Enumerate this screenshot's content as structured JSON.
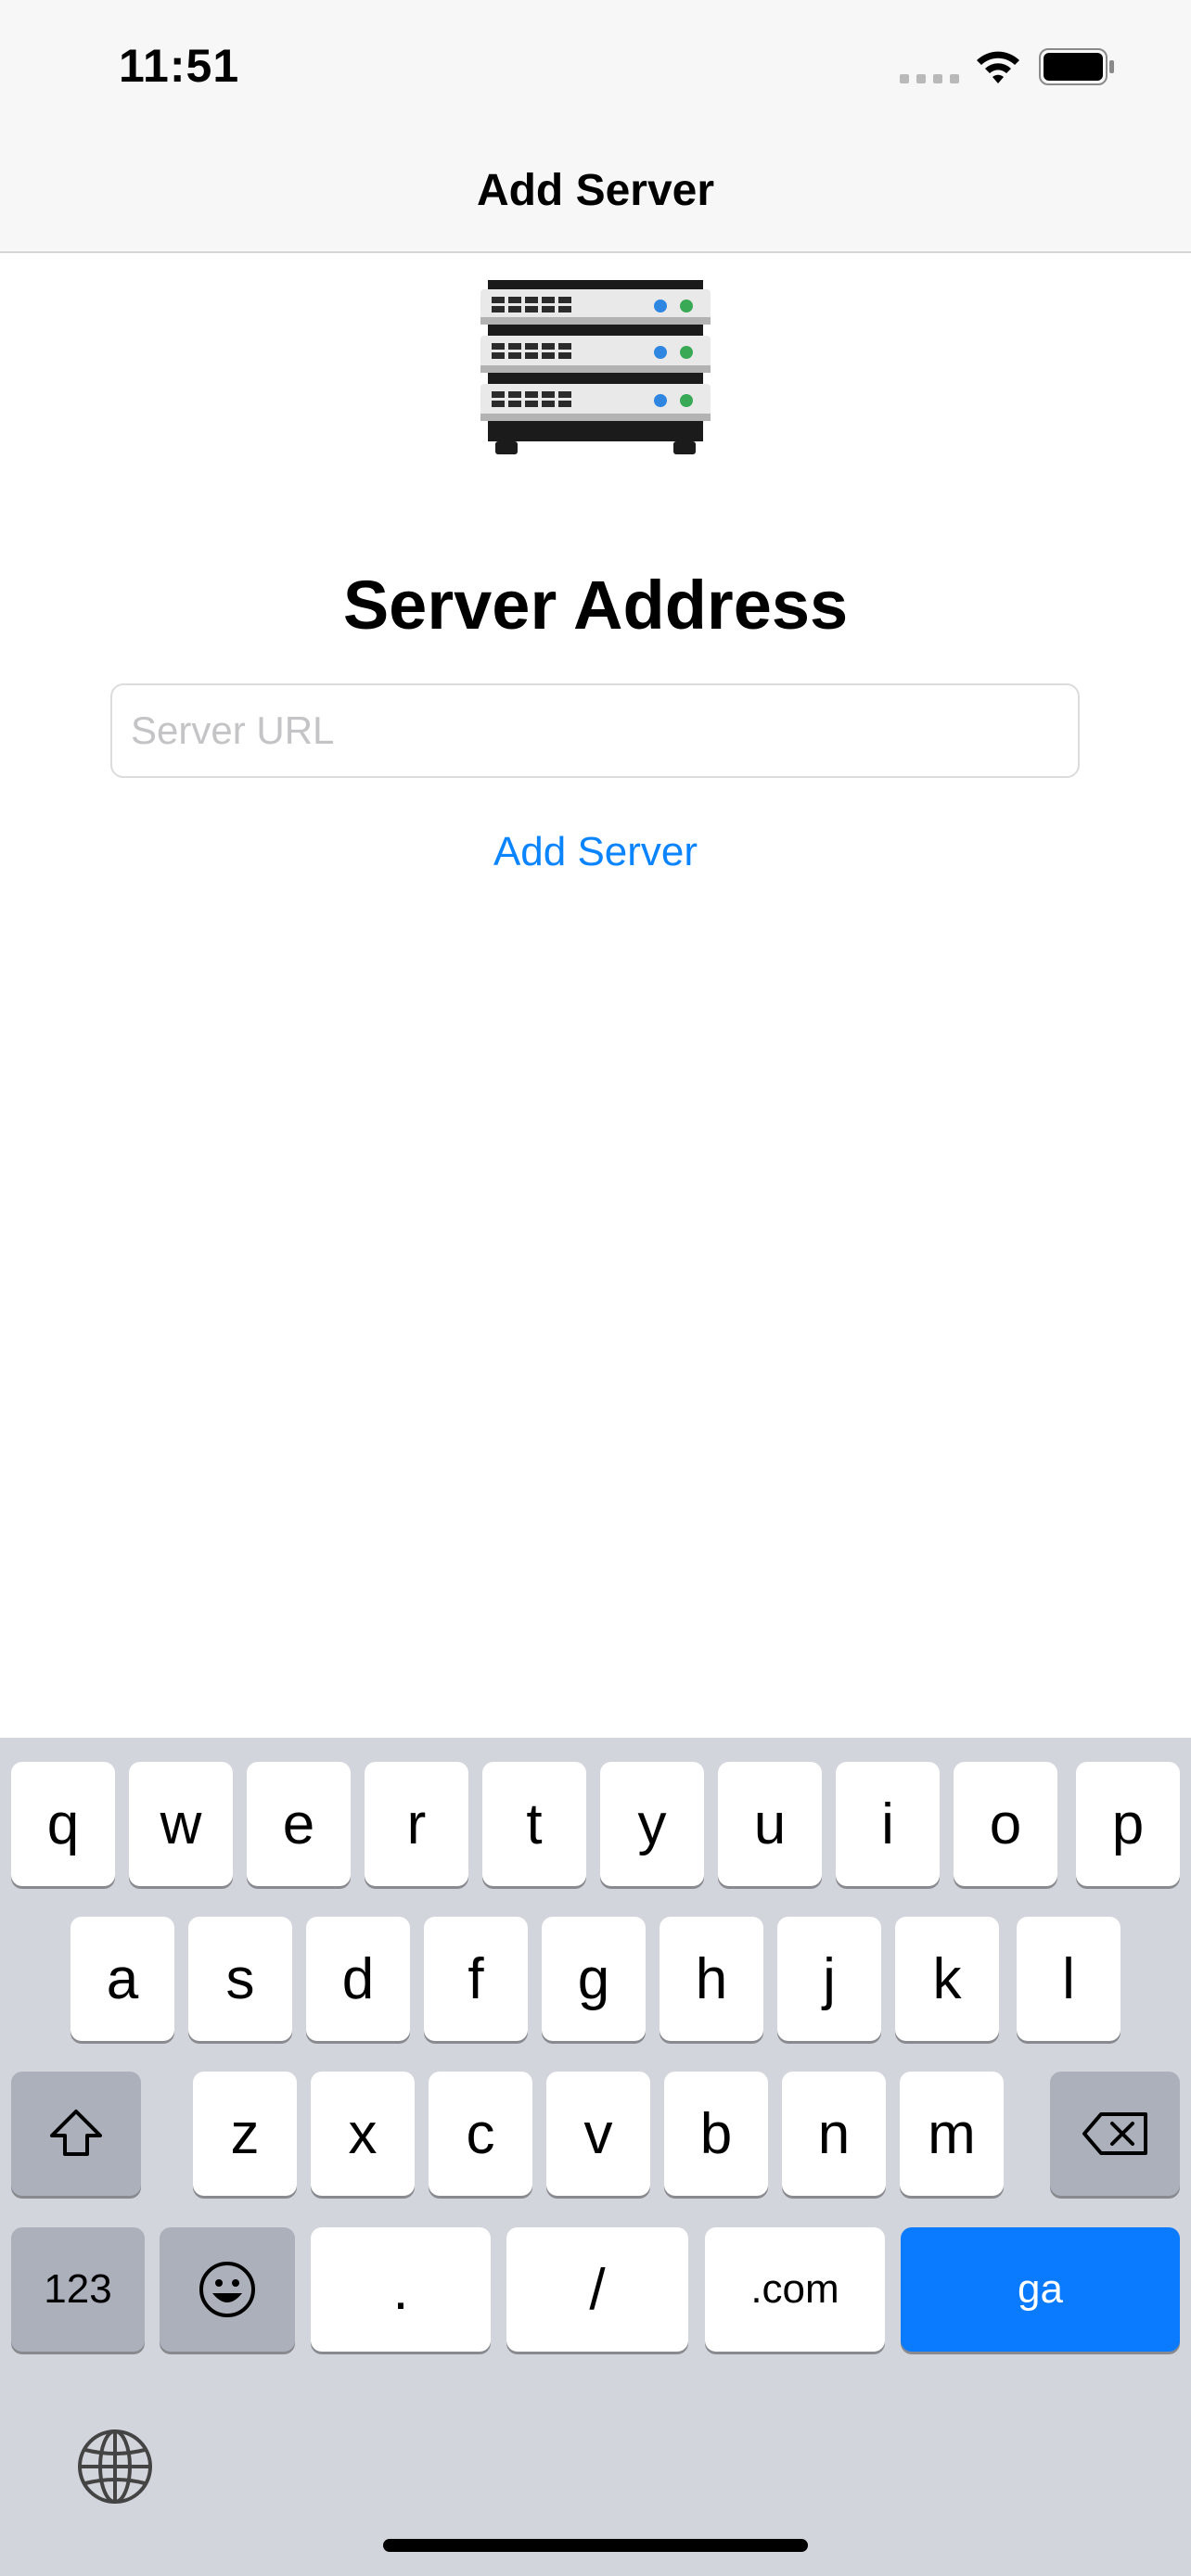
{
  "status_bar": {
    "time": "11:51"
  },
  "nav": {
    "title": "Add Server"
  },
  "content": {
    "heading": "Server Address",
    "url_placeholder": "Server URL",
    "url_value": "",
    "add_button_label": "Add Server"
  },
  "keyboard": {
    "row1": [
      "q",
      "w",
      "e",
      "r",
      "t",
      "y",
      "u",
      "i",
      "o",
      "p"
    ],
    "row2": [
      "a",
      "s",
      "d",
      "f",
      "g",
      "h",
      "j",
      "k",
      "l"
    ],
    "row3": [
      "z",
      "x",
      "c",
      "v",
      "b",
      "n",
      "m"
    ],
    "numbers_key": "123",
    "dot_key": ".",
    "slash_key": "/",
    "dotcom_key": ".com",
    "go_key": "ga"
  },
  "colors": {
    "accent": "#0a84ff",
    "keyboard_bg": "#d3d5dc",
    "go_key": "#0a7aff"
  },
  "icons": [
    "wifi-icon",
    "battery-icon",
    "server-icon",
    "shift-icon",
    "backspace-icon",
    "emoji-icon",
    "globe-icon"
  ]
}
